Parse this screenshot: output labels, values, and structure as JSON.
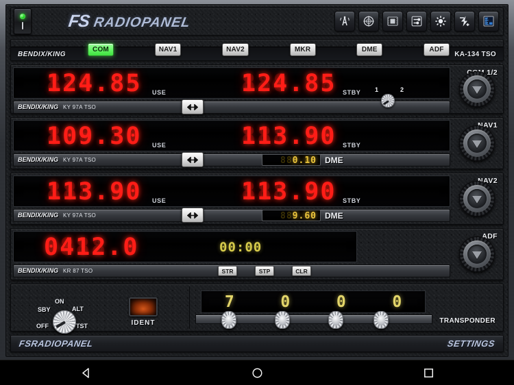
{
  "header": {
    "power_switch": {
      "name": "power",
      "led_color": "#2bdc2b",
      "marker": "I"
    },
    "brand_fs": "FS",
    "brand_name": "RADIOPANEL",
    "icons": [
      {
        "name": "antenna-icon",
        "label": "Antenna"
      },
      {
        "name": "compass-icon",
        "label": "Compass"
      },
      {
        "name": "panel-icon",
        "label": "Panel"
      },
      {
        "name": "connect-icon",
        "label": "Connect"
      },
      {
        "name": "brightness-icon",
        "label": "Brightness"
      },
      {
        "name": "flash-add-icon",
        "label": "Flash"
      },
      {
        "name": "display-icon",
        "label": "Display"
      }
    ]
  },
  "selector": {
    "brand": "BENDIX/KING",
    "model": "KA-134 TSO",
    "buttons": [
      {
        "label": "COM",
        "active": true
      },
      {
        "label": "NAV1",
        "active": false
      },
      {
        "label": "NAV2",
        "active": false
      },
      {
        "label": "MKR",
        "active": false
      },
      {
        "label": "DME",
        "active": false
      },
      {
        "label": "ADF",
        "active": false
      }
    ]
  },
  "com": {
    "unit_label": "COM 1/2",
    "active_ghost": "888.88",
    "active_freq": "124.85",
    "use_label": "USE",
    "standby_ghost": "888.88",
    "standby_freq": "124.85",
    "stby_label": "STBY",
    "brand": "BENDIX/KING",
    "model": "KY 97A TSO",
    "swap_icon": "swap-arrows",
    "selector_1": "1",
    "selector_2": "2"
  },
  "nav1": {
    "unit_label": "NAV1",
    "active_ghost": "888.88",
    "active_freq": "109.30",
    "use_label": "USE",
    "standby_ghost": "888.88",
    "standby_freq": "113.90",
    "stby_label": "STBY",
    "brand": "BENDIX/KING",
    "model": "KY 97A TSO",
    "dme_ghost": "888.88",
    "dme_value": "  0.10",
    "dme_label": "DME"
  },
  "nav2": {
    "unit_label": "NAV2",
    "active_ghost": "888.88",
    "active_freq": "113.90",
    "use_label": "USE",
    "standby_ghost": "888.88",
    "standby_freq": "113.90",
    "stby_label": "STBY",
    "brand": "BENDIX/KING",
    "model": "KY 97A TSO",
    "dme_ghost": "888.88",
    "dme_value": "  9.60",
    "dme_label": "DME"
  },
  "adf": {
    "unit_label": "ADF",
    "freq_ghost": "8888.8",
    "freq_value": "0412.0",
    "timer": "00:00",
    "brand": "BENDIX/KING",
    "model": "KR 87 TSO",
    "buttons": [
      {
        "label": "STR"
      },
      {
        "label": "STP"
      },
      {
        "label": "CLR"
      }
    ]
  },
  "transponder": {
    "mode_labels": {
      "off": "OFF",
      "sby": "SBY",
      "on": "ON",
      "alt": "ALT",
      "tst": "TST"
    },
    "selected_mode": "OFF",
    "ident_label": "IDENT",
    "code_digits": [
      "7",
      "0",
      "0",
      "0"
    ],
    "unit_label": "TRANSPONDER"
  },
  "footer": {
    "left": "FSRADIOPANEL",
    "right": "SETTINGS"
  },
  "navbar": {
    "back": "back-triangle",
    "home": "home-circle",
    "recents": "recents-square"
  },
  "colors": {
    "accent_green": "#62f462",
    "led_red": "#ff1d17",
    "led_amber": "#e2d469",
    "panel_dark": "#1b1d21"
  }
}
